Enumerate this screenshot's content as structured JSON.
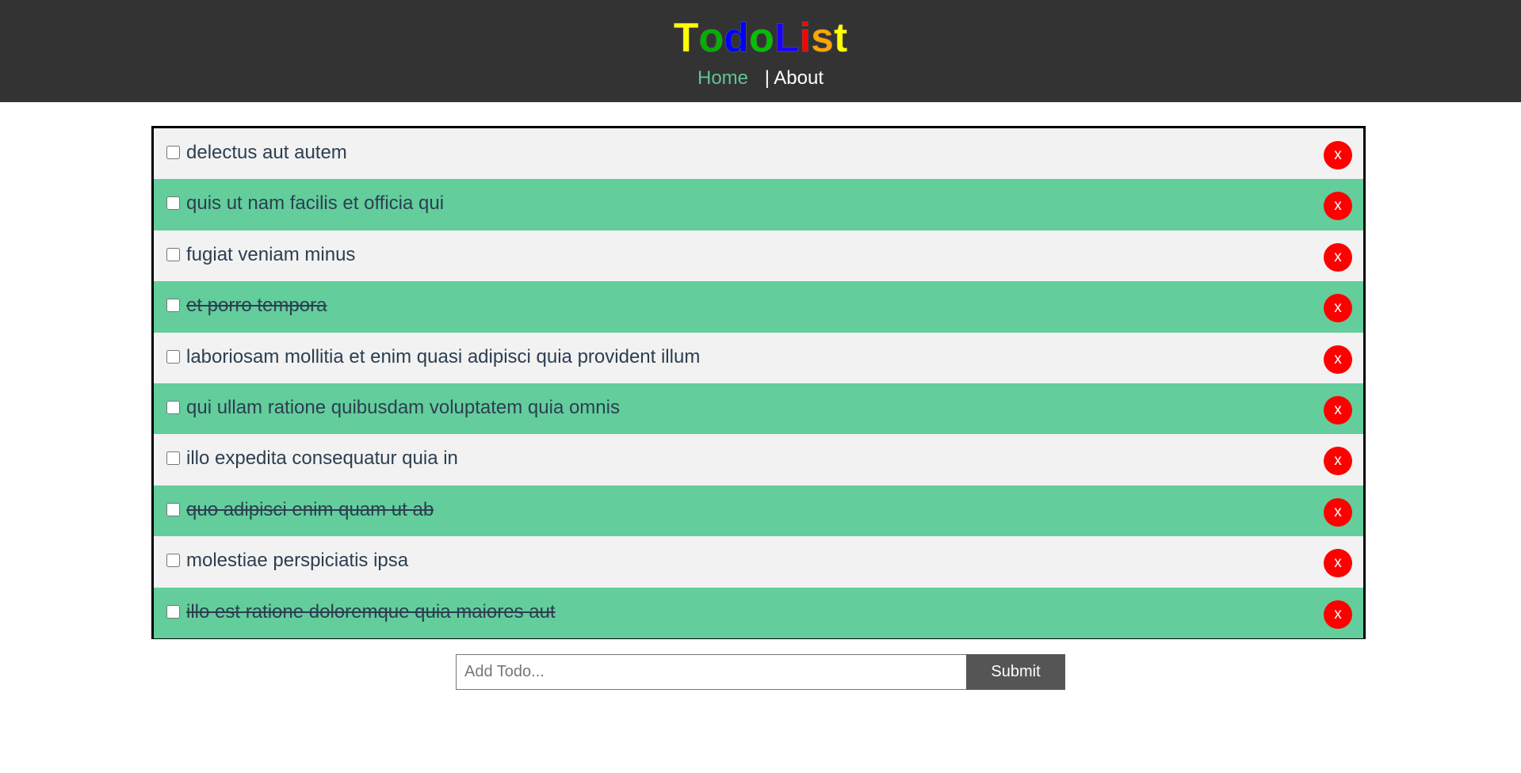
{
  "header": {
    "title_letters": [
      {
        "char": "T",
        "color": "#ffff00"
      },
      {
        "char": "o",
        "color": "#00b000"
      },
      {
        "char": "d",
        "color": "#0000ff"
      },
      {
        "char": "o",
        "color": "#00c000"
      },
      {
        "char": "L",
        "color": "#1a00ff"
      },
      {
        "char": "i",
        "color": "#ff0000"
      },
      {
        "char": "s",
        "color": "#ffa500"
      },
      {
        "char": "t",
        "color": "#ffff00"
      }
    ],
    "nav": {
      "home_label": "Home",
      "separator": "|",
      "about_label": "About"
    }
  },
  "todos": [
    {
      "title": "delectus aut autem",
      "completed": false
    },
    {
      "title": "quis ut nam facilis et officia qui",
      "completed": false
    },
    {
      "title": "fugiat veniam minus",
      "completed": false
    },
    {
      "title": "et porro tempora",
      "completed": true
    },
    {
      "title": "laboriosam mollitia et enim quasi adipisci quia provident illum",
      "completed": false
    },
    {
      "title": "qui ullam ratione quibusdam voluptatem quia omnis",
      "completed": false
    },
    {
      "title": "illo expedita consequatur quia in",
      "completed": false
    },
    {
      "title": "quo adipisci enim quam ut ab",
      "completed": true
    },
    {
      "title": "molestiae perspiciatis ipsa",
      "completed": false
    },
    {
      "title": "illo est ratione doloremque quia maiores aut",
      "completed": true
    }
  ],
  "delete_label": "x",
  "add_form": {
    "placeholder": "Add Todo...",
    "value": "",
    "submit_label": "Submit"
  },
  "colors": {
    "header_bg": "#333333",
    "home_link": "#5fc596",
    "row_light": "#f2f2f2",
    "row_green": "#63cd9c",
    "delete_button": "#ff0000",
    "submit_button": "#555555"
  }
}
